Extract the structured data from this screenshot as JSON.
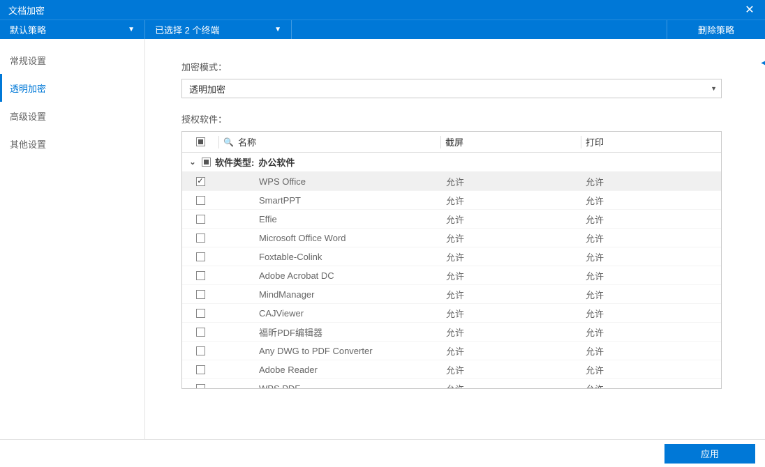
{
  "window": {
    "title": "文档加密",
    "close_icon": "✕"
  },
  "toolbar": {
    "policy_dropdown": "默认策略",
    "terminal_dropdown": "已选择 2 个终端",
    "delete_button": "删除策略"
  },
  "sidebar": {
    "items": [
      {
        "label": "常规设置",
        "active": false
      },
      {
        "label": "透明加密",
        "active": true
      },
      {
        "label": "高级设置",
        "active": false
      },
      {
        "label": "其他设置",
        "active": false
      }
    ]
  },
  "main": {
    "mode_label": "加密模式：",
    "mode_value": "透明加密",
    "software_label": "授权软件：",
    "table": {
      "header": {
        "name": "名称",
        "screen": "截屏",
        "print": "打印",
        "search_placeholder": "名称"
      },
      "group": {
        "prefix": "软件类型:",
        "name": "办公软件"
      },
      "rows": [
        {
          "checked": true,
          "name": "WPS Office",
          "screen": "允许",
          "print": "允许",
          "selected": true
        },
        {
          "checked": false,
          "name": "SmartPPT",
          "screen": "允许",
          "print": "允许"
        },
        {
          "checked": false,
          "name": "Effie",
          "screen": "允许",
          "print": "允许"
        },
        {
          "checked": false,
          "name": "Microsoft Office Word",
          "screen": "允许",
          "print": "允许"
        },
        {
          "checked": false,
          "name": "Foxtable-Colink",
          "screen": "允许",
          "print": "允许"
        },
        {
          "checked": false,
          "name": "Adobe Acrobat DC",
          "screen": "允许",
          "print": "允许"
        },
        {
          "checked": false,
          "name": "MindManager",
          "screen": "允许",
          "print": "允许"
        },
        {
          "checked": false,
          "name": "CAJViewer",
          "screen": "允许",
          "print": "允许"
        },
        {
          "checked": false,
          "name": "福昕PDF编辑器",
          "screen": "允许",
          "print": "允许"
        },
        {
          "checked": false,
          "name": "Any DWG to PDF Converter",
          "screen": "允许",
          "print": "允许"
        },
        {
          "checked": false,
          "name": "Adobe Reader",
          "screen": "允许",
          "print": "允许"
        },
        {
          "checked": false,
          "name": "WPS PDF",
          "screen": "允许",
          "print": "允许"
        }
      ]
    }
  },
  "footer": {
    "apply": "应用"
  }
}
